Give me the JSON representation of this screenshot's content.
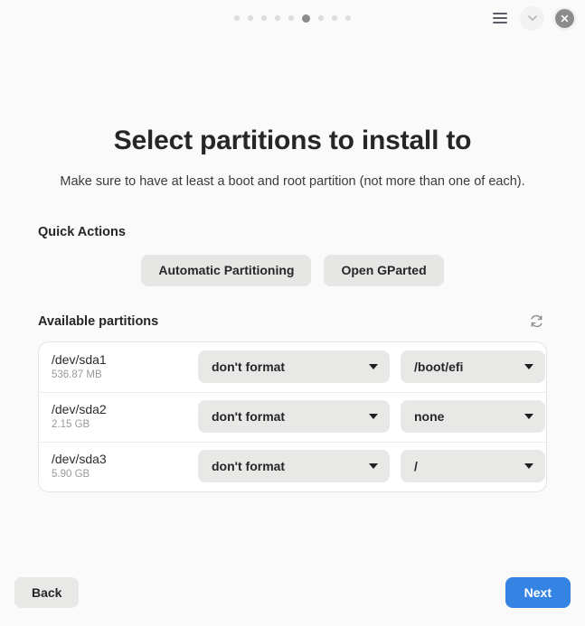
{
  "header": {
    "progress_dots": {
      "total": 9,
      "active_index": 5
    },
    "menu_icon": "hamburger-menu-icon",
    "collapse_icon": "chevron-down-icon",
    "close_icon": "close-icon"
  },
  "main": {
    "title": "Select partitions to install to",
    "subtitle": "Make sure to have at least a boot and root partition (not more than one of each).",
    "quick_actions": {
      "label": "Quick Actions",
      "buttons": [
        {
          "label": "Automatic Partitioning"
        },
        {
          "label": "Open GParted"
        }
      ]
    },
    "available_partitions": {
      "label": "Available partitions",
      "refresh_icon": "refresh-icon",
      "columns": [
        "device",
        "size",
        "format_action",
        "mount_point"
      ],
      "rows": [
        {
          "device": "/dev/sda1",
          "size": "536.87 MB",
          "format_action": "don't format",
          "mount_point": "/boot/efi"
        },
        {
          "device": "/dev/sda2",
          "size": "2.15 GB",
          "format_action": "don't format",
          "mount_point": "none"
        },
        {
          "device": "/dev/sda3",
          "size": "5.90 GB",
          "format_action": "don't format",
          "mount_point": "/"
        }
      ]
    }
  },
  "footer": {
    "back_label": "Back",
    "next_label": "Next"
  },
  "colors": {
    "page_background": "#fafafa",
    "card_background": "#ffffff",
    "accent_blue": "#3584e4",
    "button_gray": "#e8e8e7",
    "muted_text": "#9a9a9a"
  }
}
